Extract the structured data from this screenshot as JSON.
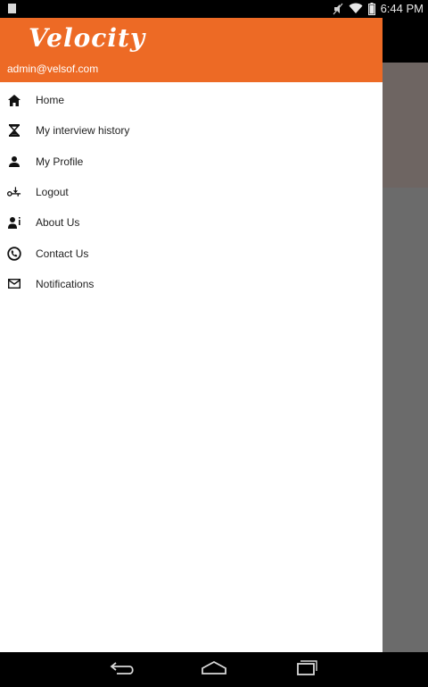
{
  "status_bar": {
    "time": "6:44 PM",
    "icons": [
      "notification-square-icon",
      "mute-icon",
      "wifi-icon",
      "battery-icon"
    ]
  },
  "drawer": {
    "brand": "Velocity",
    "email": "admin@velsof.com",
    "accent_color": "#ed6a25",
    "items": [
      {
        "label": "Home",
        "icon": "home-icon"
      },
      {
        "label": "My interview history",
        "icon": "hourglass-icon"
      },
      {
        "label": "My Profile",
        "icon": "person-icon"
      },
      {
        "label": "Logout",
        "icon": "logout-icon"
      },
      {
        "label": "About Us",
        "icon": "about-icon"
      },
      {
        "label": "Contact Us",
        "icon": "phone-icon"
      },
      {
        "label": "Notifications",
        "icon": "mail-icon"
      }
    ]
  },
  "nav_bar": {
    "buttons": [
      "back-icon",
      "home-nav-icon",
      "recents-icon"
    ]
  }
}
